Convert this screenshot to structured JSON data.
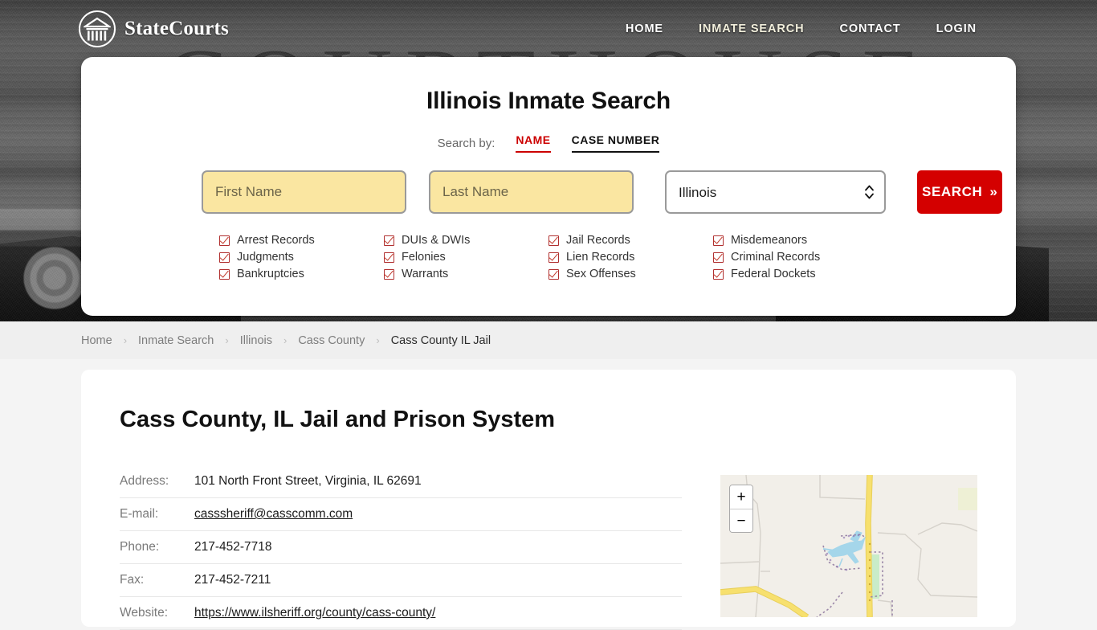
{
  "header": {
    "brand_name": "StateCourts",
    "logo_icon": "courthouse-circle-icon",
    "background_watermark": "COURTHOUSE",
    "nav": [
      {
        "label": "HOME",
        "active": false
      },
      {
        "label": "INMATE SEARCH",
        "active": true
      },
      {
        "label": "CONTACT",
        "active": false
      },
      {
        "label": "LOGIN",
        "active": false
      }
    ]
  },
  "search_panel": {
    "title": "Illinois Inmate Search",
    "search_by_label": "Search by:",
    "tabs": [
      {
        "label": "NAME",
        "active": true,
        "color": "#cc0000"
      },
      {
        "label": "CASE NUMBER",
        "active": false,
        "color": "#111111"
      }
    ],
    "first_name": {
      "placeholder": "First Name",
      "value": ""
    },
    "last_name": {
      "placeholder": "Last Name",
      "value": ""
    },
    "state_select": {
      "value": "Illinois",
      "options": [
        "Illinois"
      ]
    },
    "search_button": {
      "label": "SEARCH",
      "chevron": "»",
      "color": "#d40000"
    },
    "record_types": [
      "Arrest Records",
      "DUIs & DWIs",
      "Jail Records",
      "Misdemeanors",
      "Judgments",
      "Felonies",
      "Lien Records",
      "Criminal Records",
      "Bankruptcies",
      "Warrants",
      "Sex Offenses",
      "Federal Dockets"
    ]
  },
  "breadcrumb": {
    "separator": "›",
    "items": [
      {
        "label": "Home",
        "current": false
      },
      {
        "label": "Inmate Search",
        "current": false
      },
      {
        "label": "Illinois",
        "current": false
      },
      {
        "label": "Cass County",
        "current": false
      },
      {
        "label": "Cass County IL Jail",
        "current": true
      }
    ]
  },
  "main": {
    "title": "Cass County, IL Jail and Prison System",
    "details": [
      {
        "label": "Address:",
        "value": "101 North Front Street, Virginia, IL 62691",
        "link": false
      },
      {
        "label": "E-mail:",
        "value": "casssheriff@casscomm.com",
        "link": true
      },
      {
        "label": "Phone:",
        "value": "217-452-7718",
        "link": false
      },
      {
        "label": "Fax:",
        "value": "217-452-7211",
        "link": false
      },
      {
        "label": "Website:",
        "value": "https://www.ilsheriff.org/county/cass-county/",
        "link": true
      }
    ]
  },
  "map": {
    "zoom_in_label": "+",
    "zoom_out_label": "−",
    "background_color": "#f2efe9",
    "road_color": "#f7e06e",
    "water_color": "#a5d6ea"
  }
}
